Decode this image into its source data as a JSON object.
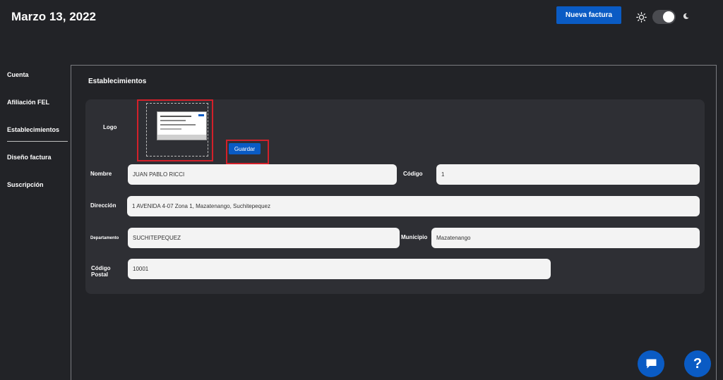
{
  "header": {
    "date": "Marzo 13, 2022",
    "new_invoice_label": "Nueva factura",
    "theme_icons": [
      "sun-icon",
      "moon-icon"
    ]
  },
  "sidebar": {
    "items": [
      {
        "label": "Cuenta"
      },
      {
        "label": "Afiliación FEL"
      },
      {
        "label": "Establecimientos"
      },
      {
        "label": "Diseño factura"
      },
      {
        "label": "Suscripción"
      }
    ],
    "active_index": 2
  },
  "panel": {
    "title": "Establecimientos"
  },
  "form": {
    "logo_label": "Logo",
    "save_label": "Guardar",
    "nombre_label": "Nombre",
    "nombre_value": "JUAN PABLO RICCI",
    "codigo_label": "Código",
    "codigo_value": "1",
    "direccion_label": "Dirección",
    "direccion_value": "1 AVENIDA 4-07 Zona 1, Mazatenango, Suchitepequez",
    "departamento_label": "Departamento",
    "departamento_value": "SUCHITEPEQUEZ",
    "municipio_label": "Municipio",
    "municipio_value": "Mazatenango",
    "codigo_postal_label": "Código Postal",
    "codigo_postal_value": "10001"
  },
  "fabs": {
    "help_glyph": "?",
    "icons": [
      "chat-icon",
      "help-icon"
    ]
  },
  "colors": {
    "background": "#222327",
    "card": "#2e2f34",
    "accent": "#0a5bc4",
    "highlight": "#d3202a"
  }
}
